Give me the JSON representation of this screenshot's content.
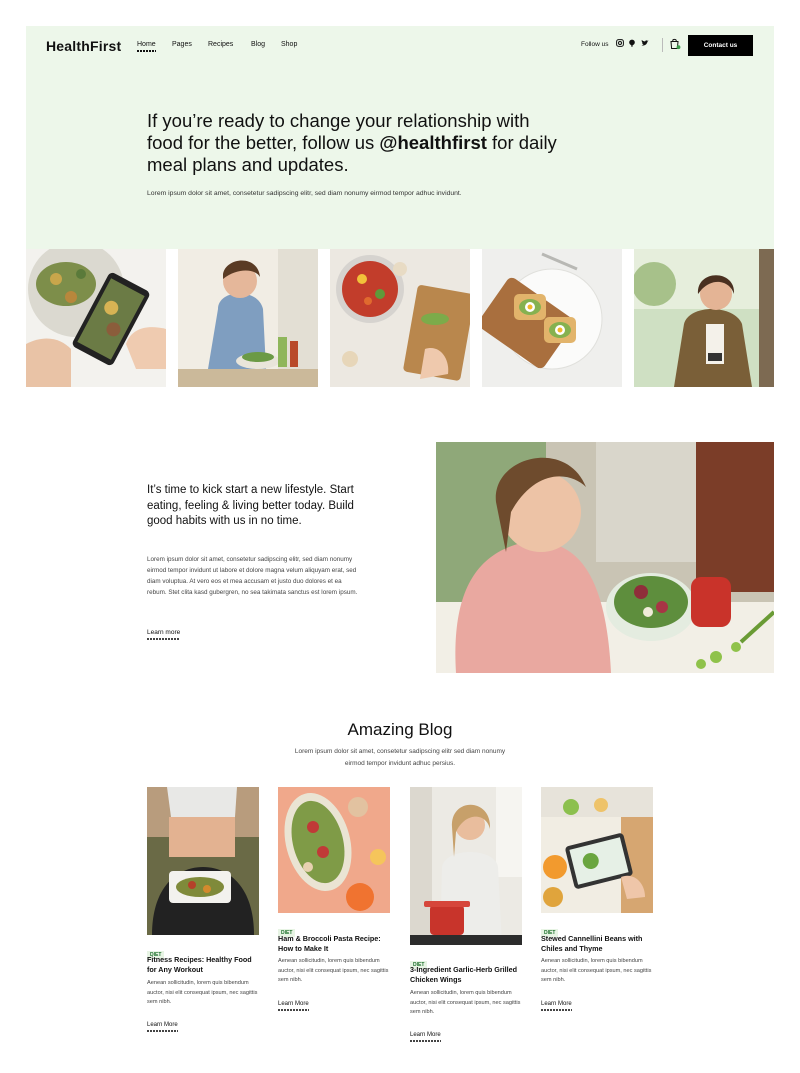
{
  "brand": {
    "logo": "HealthFirst"
  },
  "nav": {
    "items": [
      "Home",
      "Pages",
      "Recipes",
      "Blog",
      "Shop"
    ],
    "active": "Home"
  },
  "header": {
    "follow_label": "Follow us",
    "social_icons": [
      "instagram-icon",
      "pinterest-icon",
      "twitter-icon"
    ],
    "cart_icon": "cart-icon",
    "contact_label": "Contact us"
  },
  "hero": {
    "headline_pre": "If you’re ready to change your relationship with food for the better, follow us ",
    "headline_handle": "@healthfirst",
    "headline_post": " for daily meal plans and updates.",
    "lead": "Lorem ipsum dolor sit amet, consetetur sadipscing elitr, sed diam nonumy eirmod tempor adhuc invidunt."
  },
  "lifestyle": {
    "heading": "It’s time to kick start a new lifestyle. Start eating, feeling & living better today. Build good habits with us in no time.",
    "body": "Lorem ipsum dolor sit amet, consetetur sadipscing elitr, sed diam nonumy eirmod tempor invidunt ut labore et dolore magna velum aliquyam erat, sed diam voluptua. At vero eos et mea accusam et justo duo dolores et ea rebum. Stet clita kasd gubergren, no sea takimata sanctus est lorem ipsum.",
    "link": "Learn more"
  },
  "blog": {
    "title": "Amazing Blog",
    "subtitle": "Lorem ipsum dolor sit amet, consetetur sadipscing elitr sed diam nonumy eirmod tempor invidunt adhuc persius.",
    "posts": [
      {
        "tag": "DIET",
        "title": "Fitness Recipes: Healthy Food for Any Workout",
        "excerpt": "Aenean sollicitudin, lorem quis bibendum auctor, nisi elit consequat ipsum, nec sagittis sem nibh.",
        "link": "Learn More"
      },
      {
        "tag": "DIET",
        "title": "Ham & Broccoli Pasta Recipe: How to Make It",
        "excerpt": "Aenean sollicitudin, lorem quis bibendum auctor, nisi elit consequat ipsum, nec sagittis sem nibh.",
        "link": "Learn More"
      },
      {
        "tag": "DIET",
        "title": "3-Ingredient Garlic-Herb Grilled Chicken Wings",
        "excerpt": "Aenean sollicitudin, lorem quis bibendum auctor, nisi elit consequat ipsum, nec sagittis sem nibh.",
        "link": "Learn More"
      },
      {
        "tag": "DIET",
        "title": "Stewed Cannellini Beans with Chiles and Thyme",
        "excerpt": "Aenean sollicitudin, lorem quis bibendum auctor, nisi elit consequat ipsum, nec sagittis sem nibh.",
        "link": "Learn More"
      }
    ]
  },
  "colors": {
    "hero_bg": "#edf7ea",
    "accent": "#000000",
    "tag_bg": "#e7f4e4",
    "tag_text": "#1b6f2a"
  }
}
